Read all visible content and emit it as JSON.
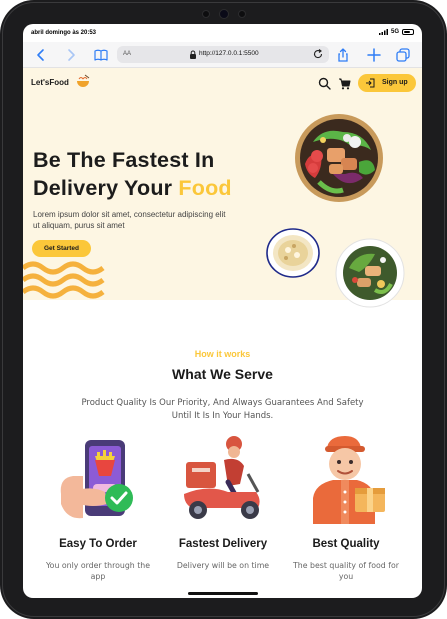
{
  "status_bar": {
    "time": "abril domingo às 20:53",
    "signal": "5G"
  },
  "browser": {
    "text_size_label": "AA",
    "url": "http://127.0.0.1:5500",
    "accent_color": "#2f7df6"
  },
  "site": {
    "logo_text": "Let'sFood",
    "signup_label": "Sign up",
    "brand_color": "#fbc73a",
    "hero": {
      "title_line1": "Be The Fastest In",
      "title_line2_prefix": "Delivery Your ",
      "title_accent": "Food",
      "description": "Lorem ipsum dolor sit amet, consectetur adipiscing elit ut aliquam, purus sit amet",
      "cta_label": "Get Started"
    },
    "how_it_works": {
      "subtitle": "How it works",
      "title": "What We Serve",
      "description": "Product Quality Is Our Priority, And Always Guarantees And Safety Until It Is In Your Hands.",
      "features": [
        {
          "title": "Easy To Order",
          "description": "You only order through the app",
          "icon": "phone-order-icon"
        },
        {
          "title": "Fastest Delivery",
          "description": "Delivery will be on time",
          "icon": "delivery-scooter-icon"
        },
        {
          "title": "Best Quality",
          "description": "The best quality of food for you",
          "icon": "chef-quality-icon"
        }
      ]
    }
  }
}
